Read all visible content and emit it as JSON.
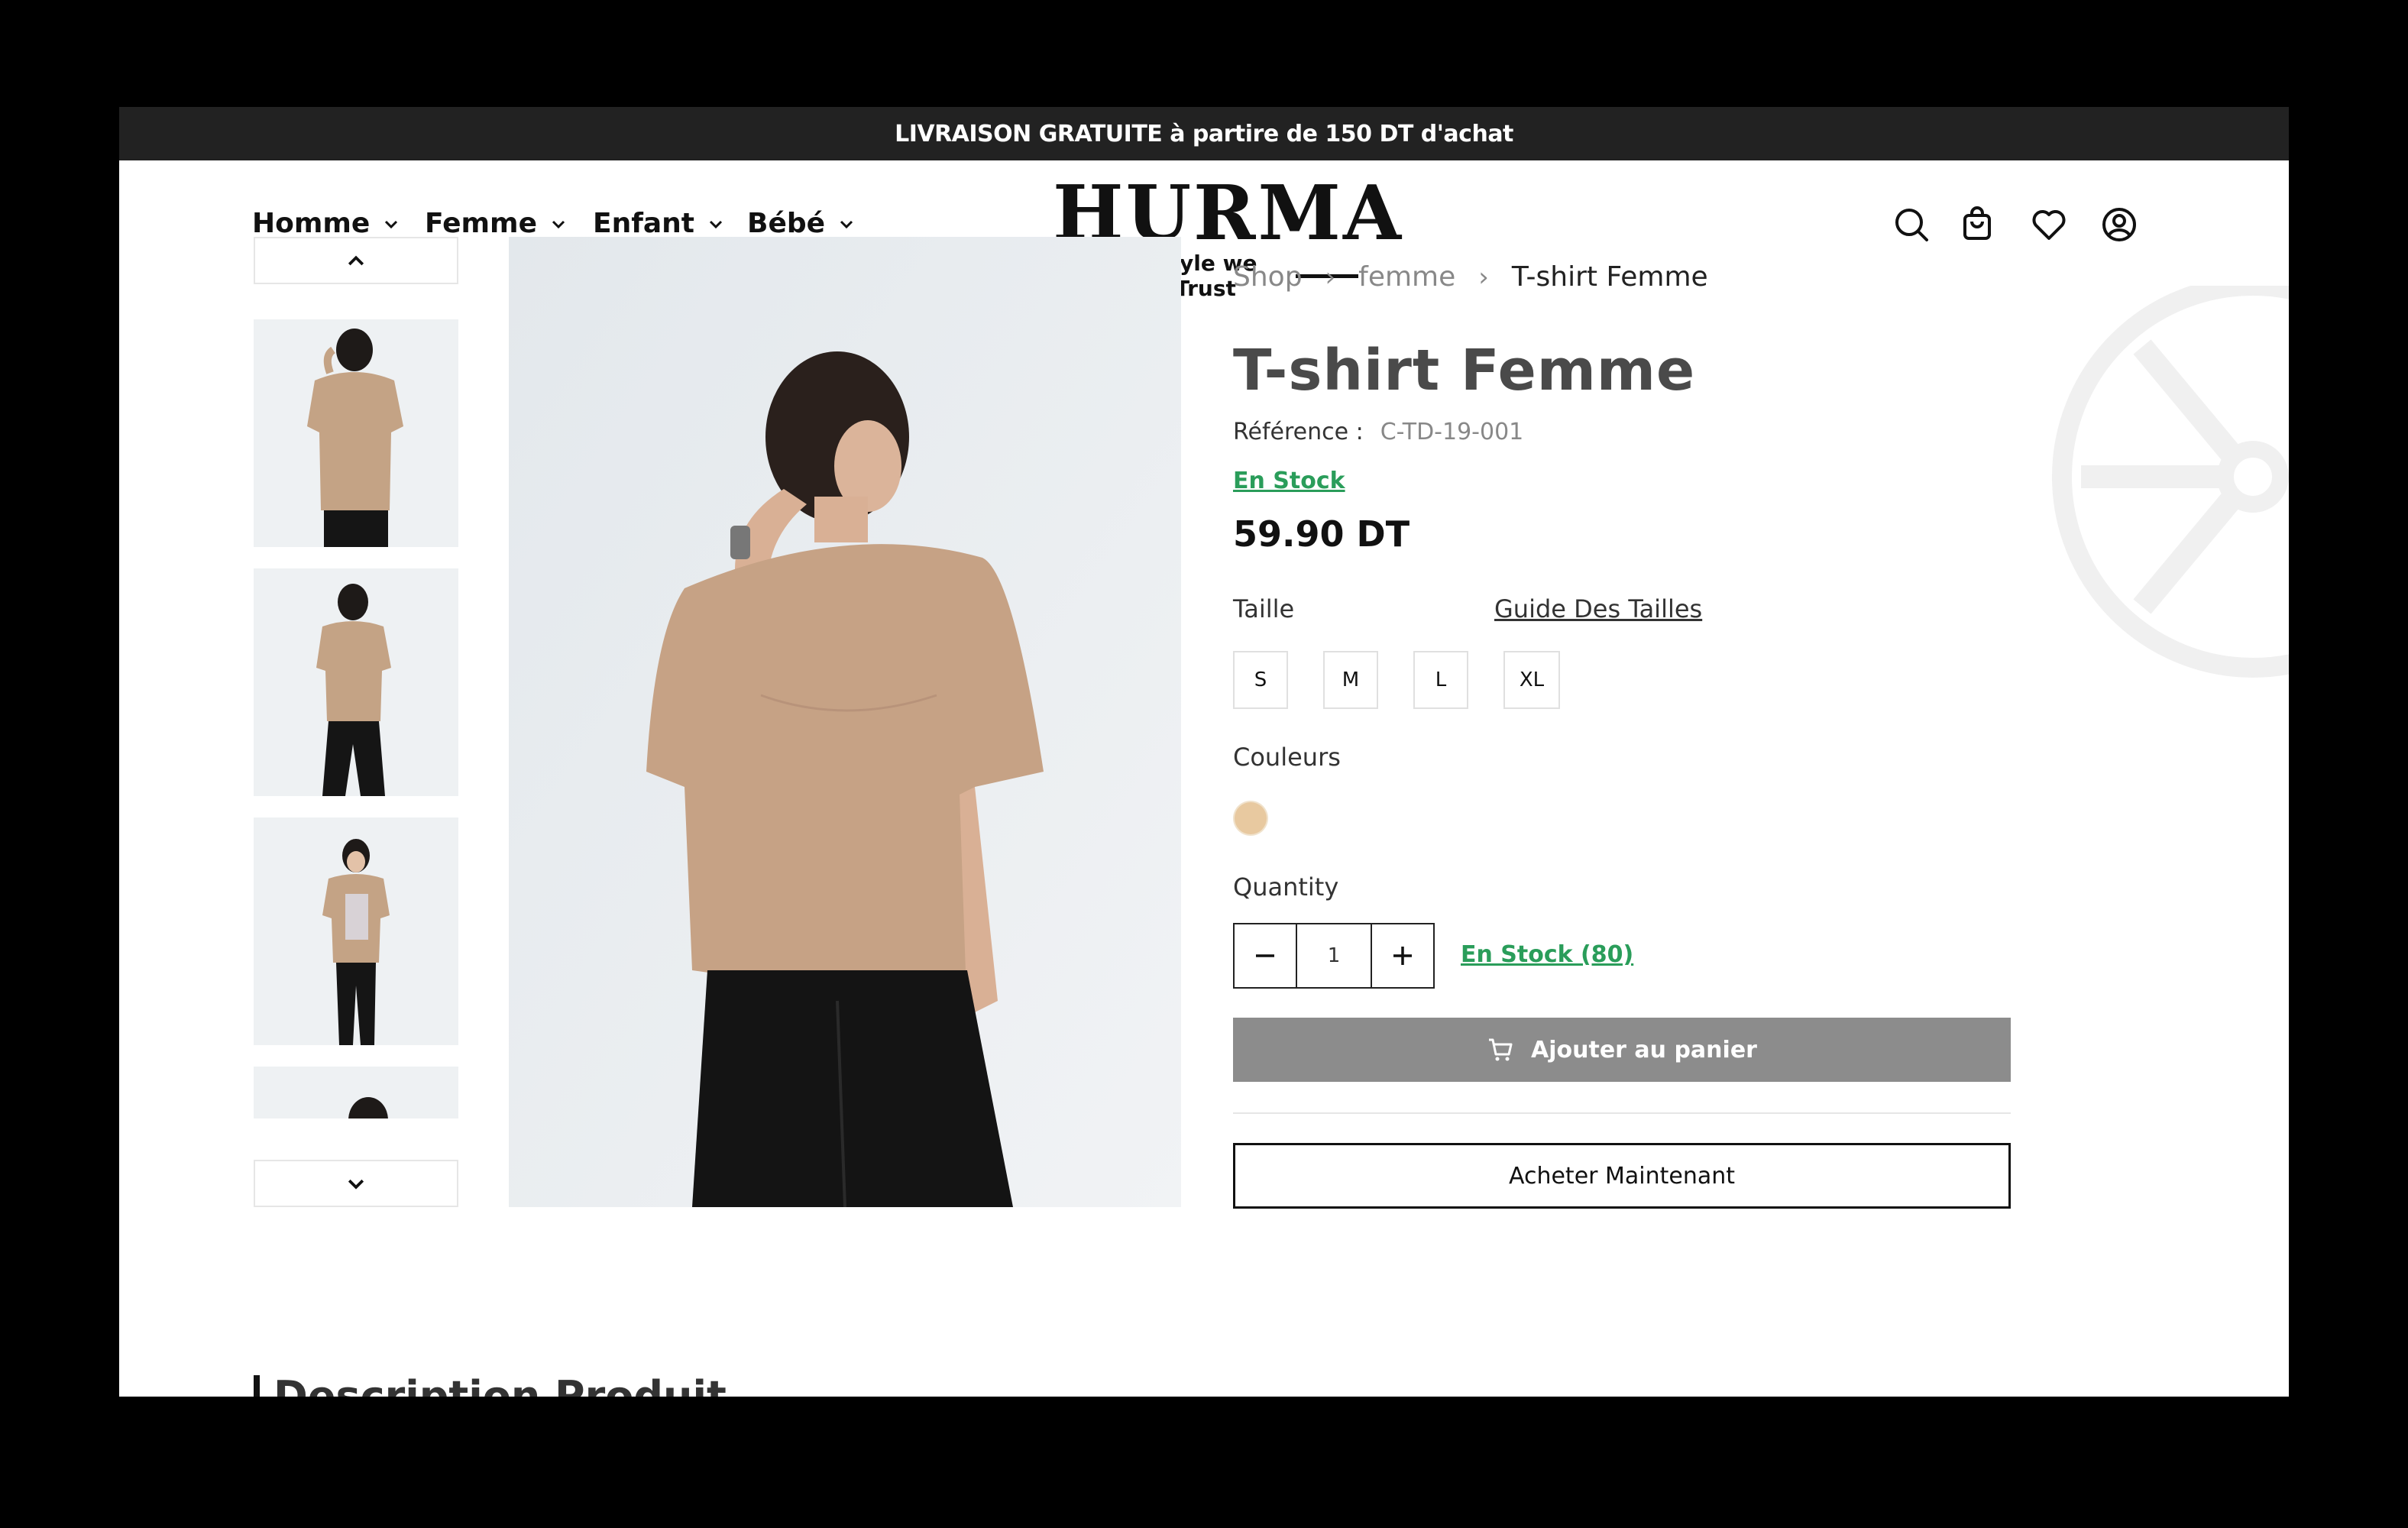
{
  "promo": {
    "text": "LIVRAISON GRATUITE à partire de 150 DT d'achat"
  },
  "nav": {
    "items": [
      {
        "label": "Homme"
      },
      {
        "label": "Femme"
      },
      {
        "label": "Enfant"
      },
      {
        "label": "Bébé"
      }
    ]
  },
  "logo": {
    "word": "HURMA",
    "tagline": "Style we Trust"
  },
  "header_icons": [
    "search-icon",
    "shopping-bag-icon",
    "heart-icon",
    "user-icon"
  ],
  "breadcrumb": {
    "shop": "Shop",
    "category": "femme",
    "current": "T-shirt Femme"
  },
  "product": {
    "title": "T-shirt Femme",
    "reference_label": "Référence :",
    "reference_value": "C-TD-19-001",
    "stock_label": "En Stock",
    "price": "59.90 DT",
    "size_label": "Taille",
    "size_guide": "Guide Des Tailles",
    "sizes": [
      "S",
      "M",
      "L",
      "XL"
    ],
    "colors_label": "Couleurs",
    "color_swatch": "#e8c9a0",
    "quantity_label": "Quantity",
    "quantity_value": "1",
    "stock_count": "En Stock (80)",
    "add_to_cart": "Ajouter au panier",
    "buy_now": "Acheter Maintenant"
  },
  "description": {
    "heading": "Description Produit"
  },
  "colors": {
    "accent_green": "#2a9d5a",
    "tshirt": "#c9a98a",
    "pants": "#151515",
    "bg_photo": "#e8ecf0"
  }
}
